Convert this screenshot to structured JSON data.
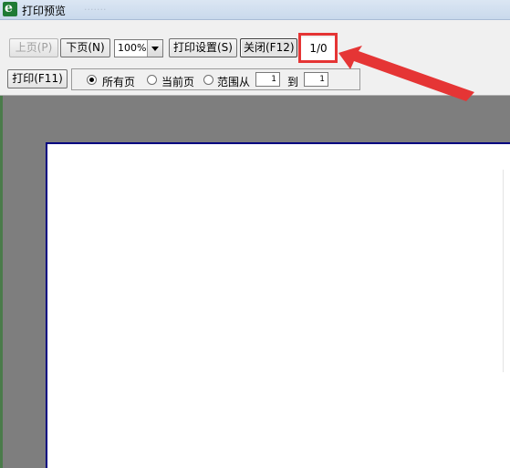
{
  "window": {
    "title": "打印预览",
    "title_blur": "·······"
  },
  "toolbar": {
    "prev_label": "上页(P)",
    "next_label": "下页(N)",
    "zoom_value": "100%",
    "settings_label": "打印设置(S)",
    "close_label": "关闭(F12)",
    "page_indicator": "1/0",
    "print_label": "打印(F11)"
  },
  "range": {
    "all_label": "所有页",
    "current_label": "当前页",
    "range_label": "范围从",
    "to_label": "到",
    "from_value": "1",
    "to_value": "1",
    "selected": "all"
  },
  "colors": {
    "highlight": "#e53535",
    "workspace": "#7e7e7e",
    "page_border": "#000080"
  }
}
